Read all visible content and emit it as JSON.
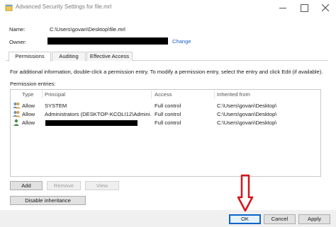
{
  "window": {
    "title": "Advanced Security Settings for file.mrl"
  },
  "fields": {
    "name_label": "Name:",
    "name_value": "C:\\Users\\govan\\Desktop\\file.mrl",
    "owner_label": "Owner:",
    "change_link": "Change"
  },
  "tabs": [
    {
      "label": "Permissions",
      "active": true
    },
    {
      "label": "Auditing",
      "active": false
    },
    {
      "label": "Effective Access",
      "active": false
    }
  ],
  "info_text": "For additional information, double-click a permission entry. To modify a permission entry, select the entry and click Edit (if available).",
  "entries_label": "Permission entries:",
  "table": {
    "headers": [
      "Type",
      "Principal",
      "Access",
      "Inherited from"
    ],
    "rows": [
      {
        "icon": "users-group-icon",
        "type": "Allow",
        "principal": "SYSTEM",
        "access": "Full control",
        "inherited": "C:\\Users\\govan\\Desktop\\"
      },
      {
        "icon": "users-group-icon",
        "type": "Allow",
        "principal": "Administrators (DESKTOP-KCOLI12\\Admini...",
        "access": "Full control",
        "inherited": "C:\\Users\\govan\\Desktop\\"
      },
      {
        "icon": "user-icon",
        "type": "Allow",
        "principal": "",
        "access": "Full control",
        "inherited": "C:\\Users\\govan\\Desktop\\"
      }
    ]
  },
  "buttons": {
    "add": "Add",
    "remove": "Remove",
    "view": "View",
    "disable_inheritance": "Disable inheritance",
    "ok": "OK",
    "cancel": "Cancel",
    "apply": "Apply"
  },
  "colors": {
    "link": "#1e63c7",
    "annotation_arrow": "#d7141a",
    "ok_border": "#0a64c8"
  }
}
